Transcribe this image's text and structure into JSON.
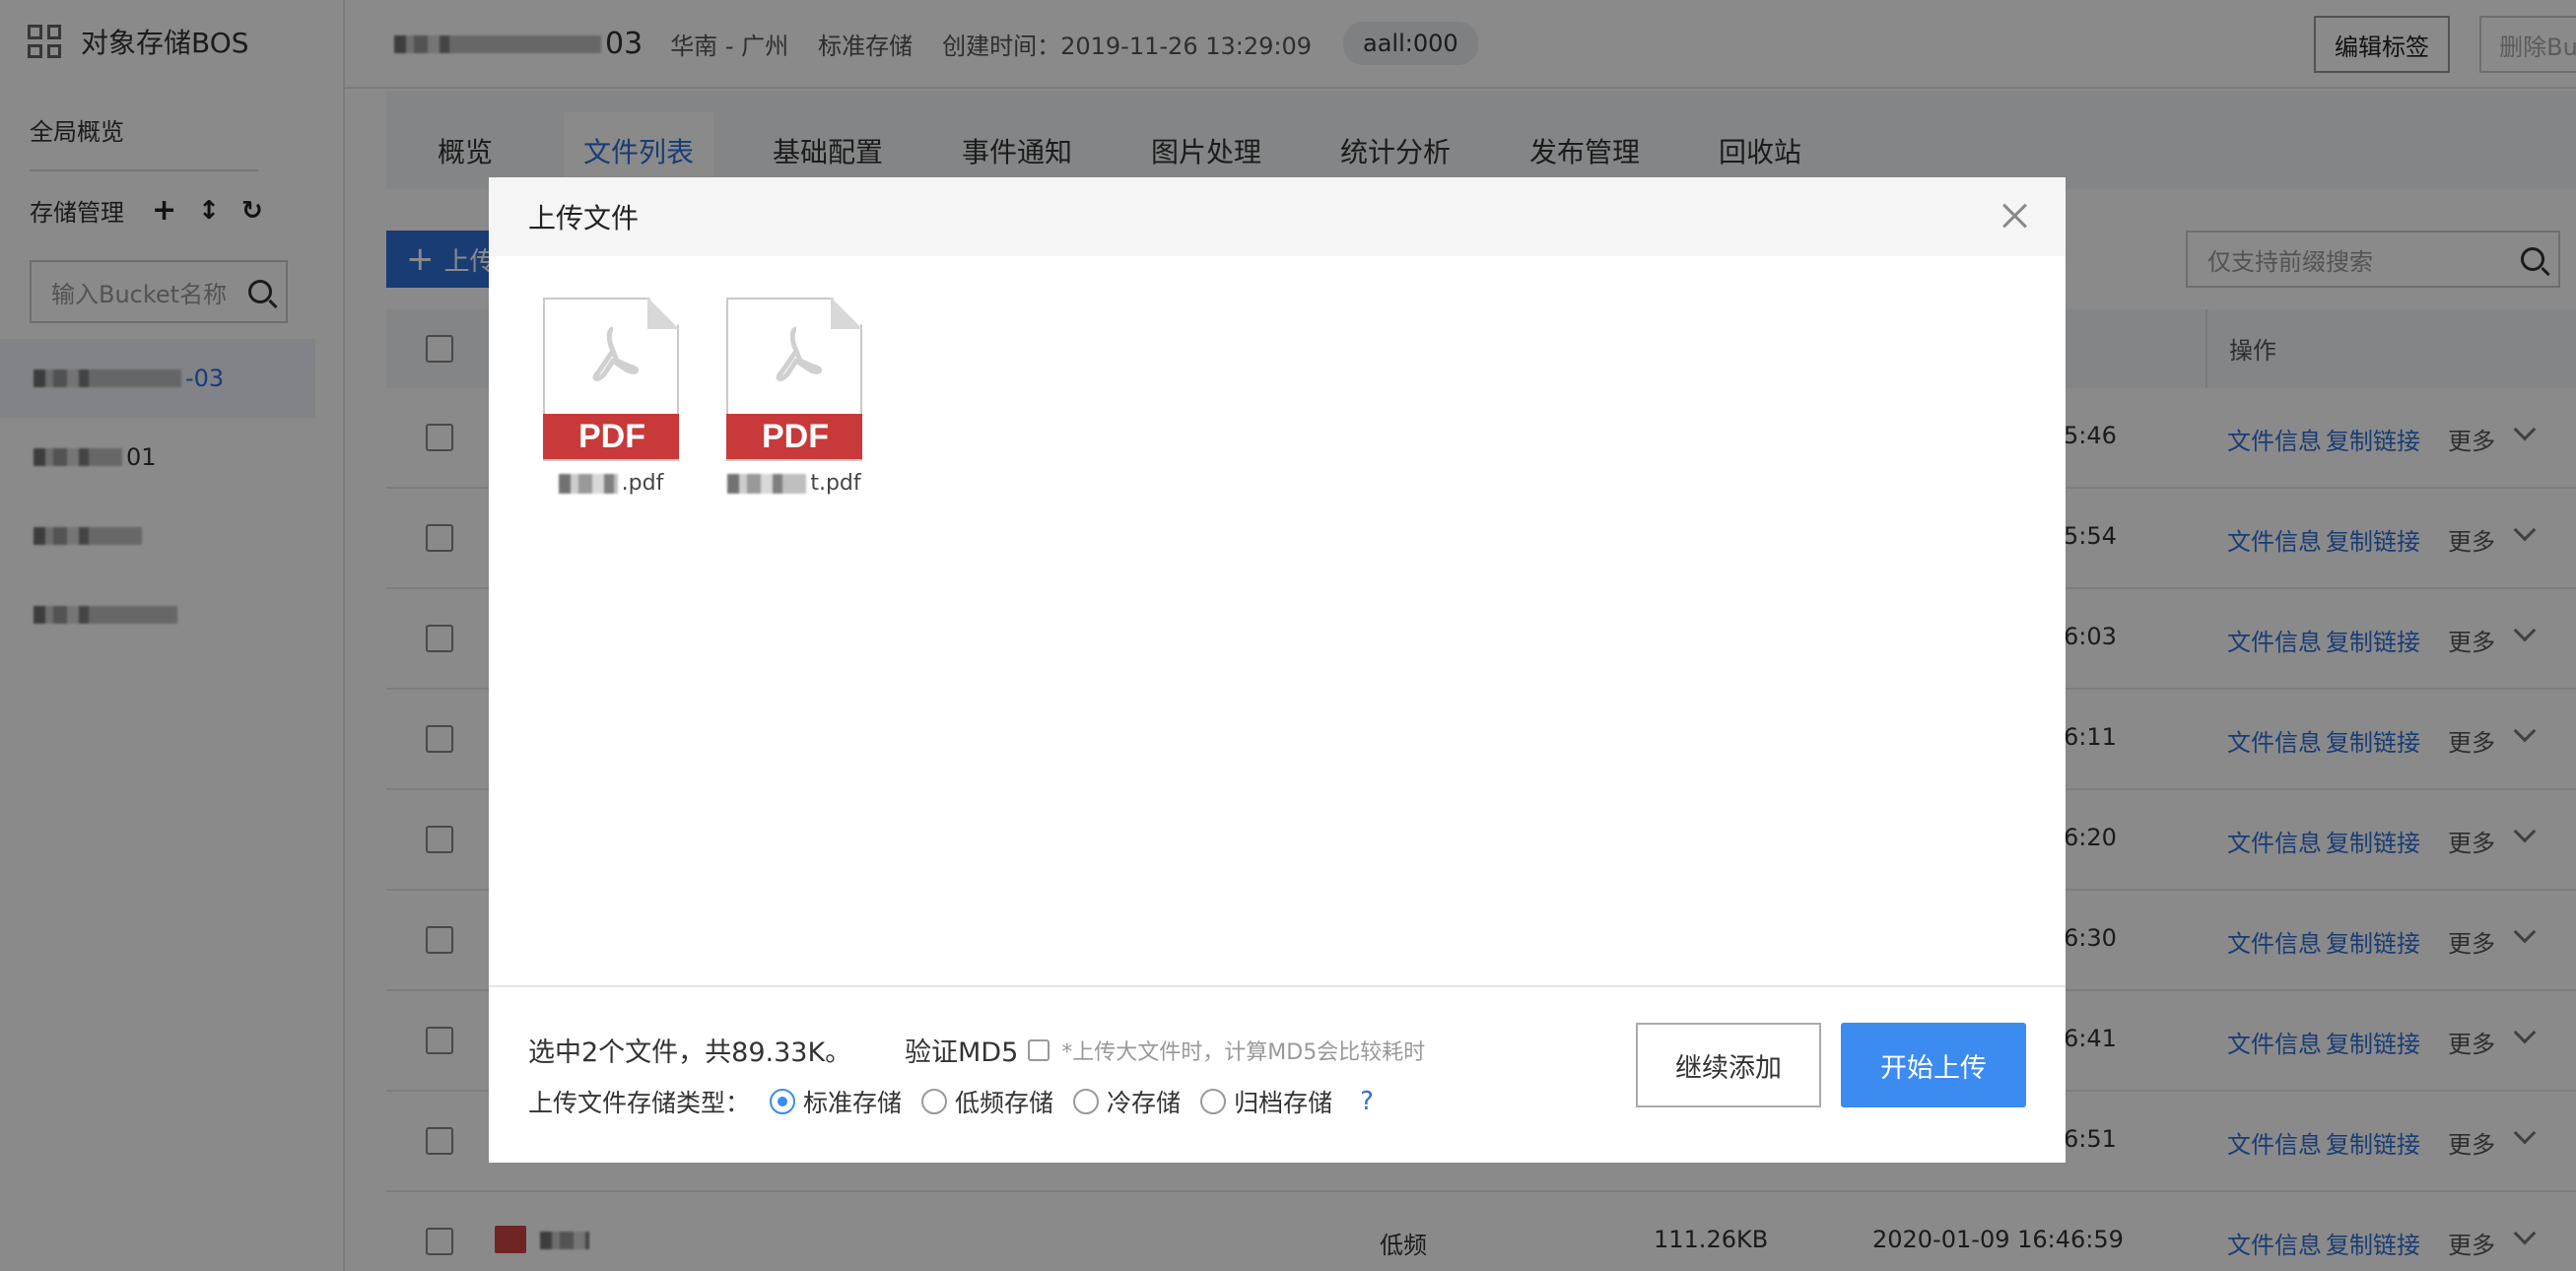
{
  "sidebar": {
    "brand": "对象存储BOS",
    "overview": "全局概览",
    "storage_label": "存储管理",
    "search_placeholder": "输入Bucket名称",
    "buckets": [
      {
        "suffix": "-03",
        "active": true
      },
      {
        "suffix": "01",
        "active": false
      },
      {
        "suffix": "",
        "active": false
      },
      {
        "suffix": "",
        "active": false
      }
    ]
  },
  "header": {
    "bucket_suffix": "03",
    "region": "华南 - 广州",
    "storage_class": "标准存储",
    "created": "创建时间：2019-11-26 13:29:09",
    "tag": "aall:000",
    "edit_tags": "编辑标签",
    "delete_bucket": "删除Bu"
  },
  "tabs": [
    "概览",
    "文件列表",
    "基础配置",
    "事件通知",
    "图片处理",
    "统计分析",
    "发布管理",
    "回收站"
  ],
  "toolbar": {
    "upload": "上传",
    "prefix_search_placeholder": "仅支持前缀搜索"
  },
  "table": {
    "op_header": "操作",
    "file_info": "文件信息",
    "copy_link": "复制链接",
    "more": "更多",
    "rows": [
      {
        "time": "5:46"
      },
      {
        "time": "5:54"
      },
      {
        "time": "6:03"
      },
      {
        "time": "6:11"
      },
      {
        "time": "6:20"
      },
      {
        "time": "6:30"
      },
      {
        "time": "6:41"
      },
      {
        "time": "6:51"
      },
      {
        "time": "2020-01-09 16:46:59",
        "class": "低频",
        "size": "111.26KB"
      }
    ]
  },
  "modal": {
    "title": "上传文件",
    "files": [
      {
        "badge": "PDF",
        "name_suffix": ".pdf"
      },
      {
        "badge": "PDF",
        "name_suffix": "t.pdf"
      }
    ],
    "summary": "选中2个文件，共89.33K。",
    "md5_label": "验证MD5",
    "md5_hint": "*上传大文件时，计算MD5会比较耗时",
    "storage_type_label": "上传文件存储类型：",
    "storage_options": [
      "标准存储",
      "低频存储",
      "冷存储",
      "归档存储"
    ],
    "selected_storage": "标准存储",
    "help": "?",
    "continue_add": "继续添加",
    "start_upload": "开始上传"
  },
  "colors": {
    "accent": "#2f6fd6",
    "primary_button": "#3b8bf0",
    "pdf_red": "#c8393a",
    "overlay": "rgba(0,0,0,0.46)"
  }
}
